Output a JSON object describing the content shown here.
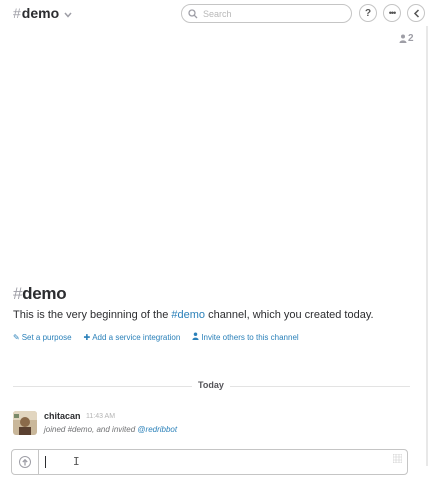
{
  "header": {
    "channel_hash": "#",
    "channel_name": "demo",
    "chevron": "⌄",
    "search_placeholder": "Search",
    "help_label": "?",
    "more_label": "•••",
    "members_count": "2"
  },
  "intro": {
    "title_hash": "#",
    "title_name": "demo",
    "text_prefix": "This is the very beginning of the ",
    "text_channel": "#demo",
    "text_suffix": " channel, which you created today.",
    "actions": [
      {
        "icon": "pencil-icon",
        "label": "Set a purpose"
      },
      {
        "icon": "plus-icon",
        "label": "Add a service integration"
      },
      {
        "icon": "user-icon",
        "label": "Invite others to this channel"
      }
    ]
  },
  "divider": {
    "label": "Today"
  },
  "messages": [
    {
      "user": "chitacan",
      "time": "11:43 AM",
      "body_prefix": "joined #demo, and invited ",
      "mention": "@redribbot"
    }
  ],
  "composer": {
    "value": ""
  },
  "colors": {
    "link": "#2a80b9",
    "text": "#2c2d30",
    "muted": "#9e9ea6"
  }
}
